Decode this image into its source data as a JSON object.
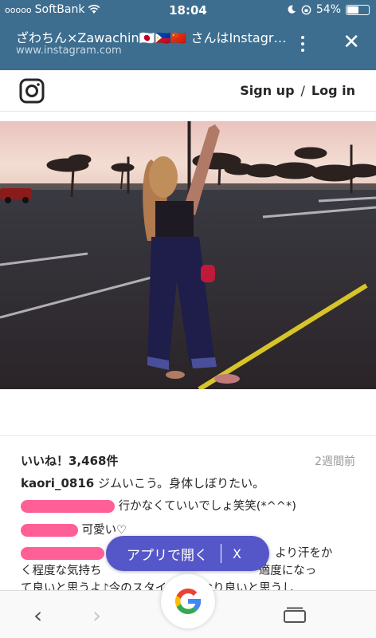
{
  "status_bar": {
    "signal_dots": "ooooo",
    "carrier": "SoftBank",
    "time": "18:04",
    "battery": "54%",
    "battery_level": 0.54
  },
  "browser": {
    "page_title": "ざわちん×Zawachin🇯🇵🇵🇭🇨🇳 さんはInstagramを利用しています",
    "url": "www.instagram.com"
  },
  "instagram": {
    "sign_up": "Sign up",
    "separator": "/",
    "log_in": "Log in"
  },
  "post": {
    "likes": "いいね！3,468件",
    "time_ago": "2週間前",
    "caption_user": "kaori_0816",
    "caption_text": "ジムいこう。身体しぼりたい。",
    "comment1": "行かなくていいでしょ笑笑(*^^*)",
    "comment2": "可愛い♡",
    "comment3_tail": "より汗をか",
    "comment4": "く程度な気持ち",
    "comment4_tail": "適度になっ",
    "comment5": "て良いと思うよ♪今のスタイルはかなり良いと思うし"
  },
  "app_banner": {
    "label": "アプリで開く",
    "close": "X"
  },
  "colors": {
    "browser_bar": "#3d6e8f",
    "banner": "#5557c9",
    "redaction": "#ff5f97"
  }
}
